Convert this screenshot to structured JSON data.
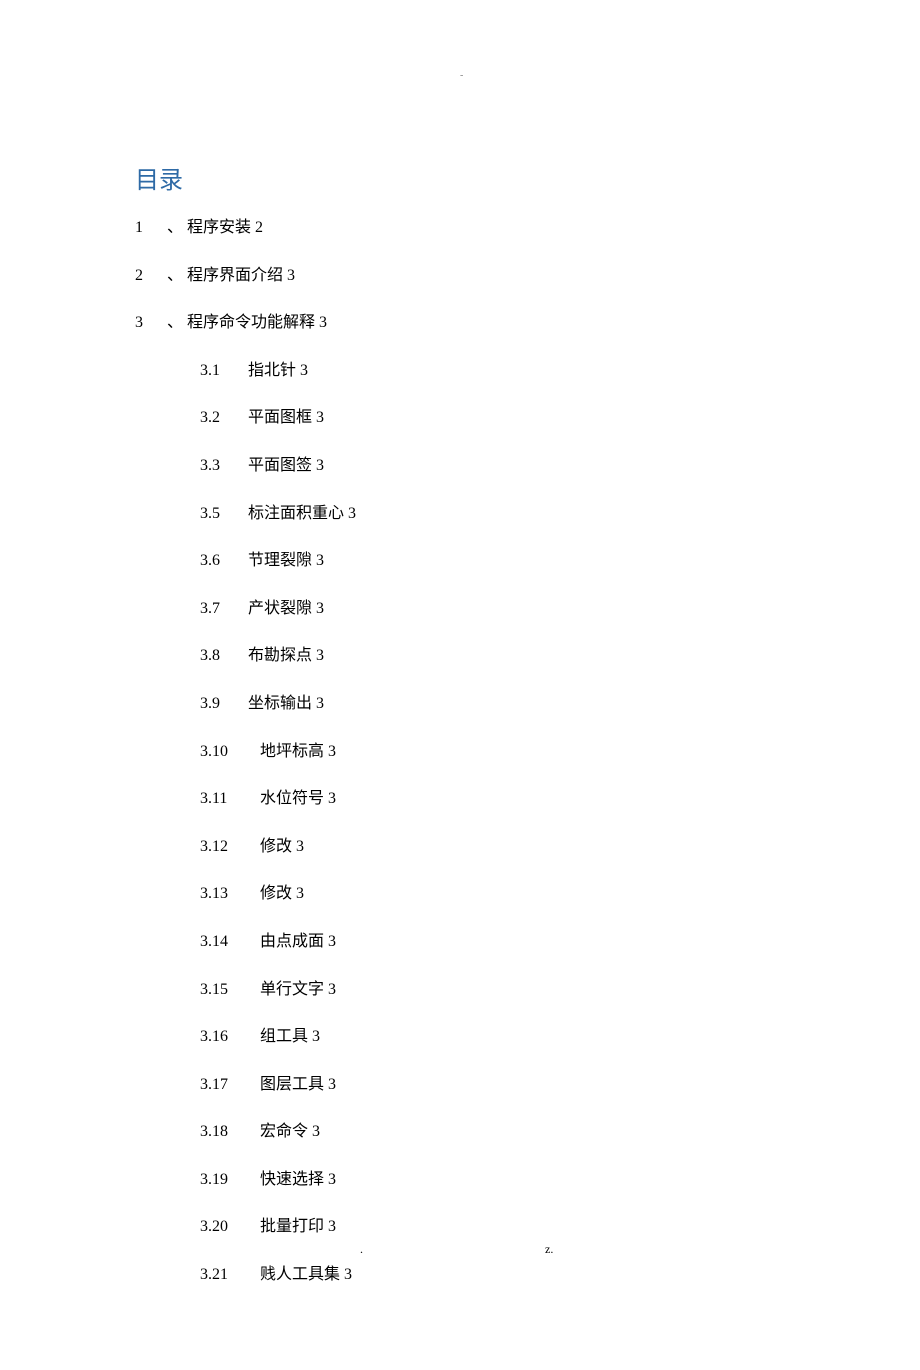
{
  "header_mark": "-",
  "title": "目录",
  "top_items": [
    {
      "num": "1",
      "sep": "、",
      "title": "程序安装",
      "page": "2"
    },
    {
      "num": "2",
      "sep": "、",
      "title": "程序界面介绍",
      "page": "3"
    },
    {
      "num": "3",
      "sep": "、",
      "title": "程序命令功能解释",
      "page": "3"
    }
  ],
  "sub_items": [
    {
      "num": "3.1",
      "title": "指北针",
      "page": "3"
    },
    {
      "num": "3.2",
      "title": "平面图框",
      "page": "3"
    },
    {
      "num": "3.3",
      "title": "平面图签",
      "page": "3"
    },
    {
      "num": "3.5",
      "title": "标注面积重心",
      "page": "3"
    },
    {
      "num": "3.6",
      "title": "节理裂隙",
      "page": "3"
    },
    {
      "num": "3.7",
      "title": "产状裂隙",
      "page": "3"
    },
    {
      "num": "3.8",
      "title": "布勘探点",
      "page": "3"
    },
    {
      "num": "3.9",
      "title": "坐标输出",
      "page": "3"
    },
    {
      "num": "3.10",
      "title": "地坪标高",
      "page": "3"
    },
    {
      "num": "3.11",
      "title": "水位符号",
      "page": "3"
    },
    {
      "num": "3.12",
      "title": "修改",
      "page": "3"
    },
    {
      "num": "3.13",
      "title": "修改",
      "page": "3"
    },
    {
      "num": "3.14",
      "title": "由点成面",
      "page": "3"
    },
    {
      "num": "3.15",
      "title": "单行文字",
      "page": "3"
    },
    {
      "num": "3.16",
      "title": "组工具",
      "page": "3"
    },
    {
      "num": "3.17",
      "title": "图层工具",
      "page": "3"
    },
    {
      "num": "3.18",
      "title": "宏命令",
      "page": "3"
    },
    {
      "num": "3.19",
      "title": "快速选择",
      "page": "3"
    },
    {
      "num": "3.20",
      "title": "批量打印",
      "page": "3"
    },
    {
      "num": "3.21",
      "title": "贱人工具集",
      "page": "3"
    }
  ],
  "footer": {
    "dot": ".",
    "z": "z."
  }
}
